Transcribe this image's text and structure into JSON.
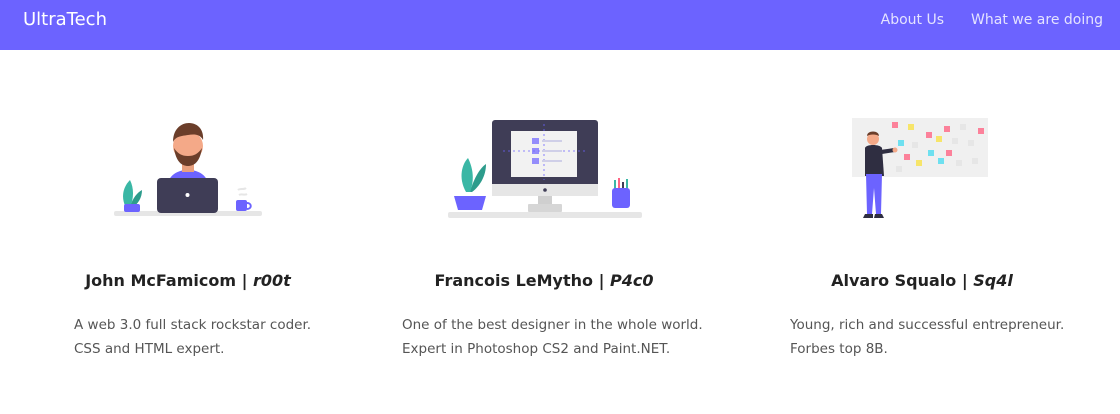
{
  "navbar": {
    "brand": "UltraTech",
    "links": [
      {
        "label": "About Us"
      },
      {
        "label": "What we are doing"
      }
    ]
  },
  "team": [
    {
      "name": "John McFamicom",
      "separator": " | ",
      "handle": "r00t",
      "bio": [
        "A web 3.0 full stack rockstar coder.",
        "CSS and HTML expert."
      ],
      "illustration": "developer-at-laptop-illustration"
    },
    {
      "name": "Francois LeMytho",
      "separator": " | ",
      "handle": "P4c0",
      "bio": [
        "One of the best designer in the whole world.",
        "Expert in Photoshop CS2 and Paint.NET."
      ],
      "illustration": "designer-monitor-illustration"
    },
    {
      "name": "Alvaro Squalo",
      "separator": " | ",
      "handle": "Sq4l",
      "bio": [
        "Young, rich and successful entrepreneur.",
        "Forbes top 8B."
      ],
      "illustration": "entrepreneur-sticky-board-illustration"
    }
  ],
  "colors": {
    "navbar": "#6c63ff",
    "accent": "#6c63ff",
    "text": "#222222",
    "muted": "#555555"
  }
}
